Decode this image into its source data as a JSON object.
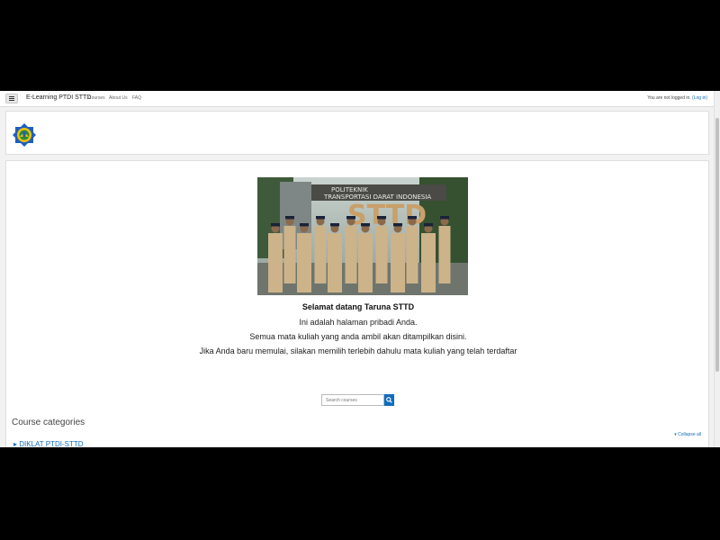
{
  "navbar": {
    "menu_icon": "hamburger-icon",
    "site_name": "E-Learning PTDI STTD",
    "links": [
      "Courses",
      "About Us",
      "FAQ"
    ],
    "login_text": "You are not logged in.",
    "login_link": "(Log in)"
  },
  "header": {
    "logo_icon": "institution-logo-icon"
  },
  "main": {
    "welcome_title": "Selamat datang Taruna STTD",
    "lines": [
      "Ini adalah halaman pribadi Anda.",
      "Semua mata kuliah yang anda ambil akan ditampilkan disini.",
      "Jika Anda baru memulai, silakan memilih terlebih dahulu mata kuliah yang telah terdaftar"
    ],
    "search_placeholder": "Search courses",
    "search_icon": "search-icon",
    "course_categories_title": "Course categories",
    "collapse_all": "Collapse all",
    "categories": [
      "DIKLAT PTDI-STTD"
    ]
  },
  "colors": {
    "accent": "#0f6cbf",
    "uniform": "#cdb38a"
  }
}
